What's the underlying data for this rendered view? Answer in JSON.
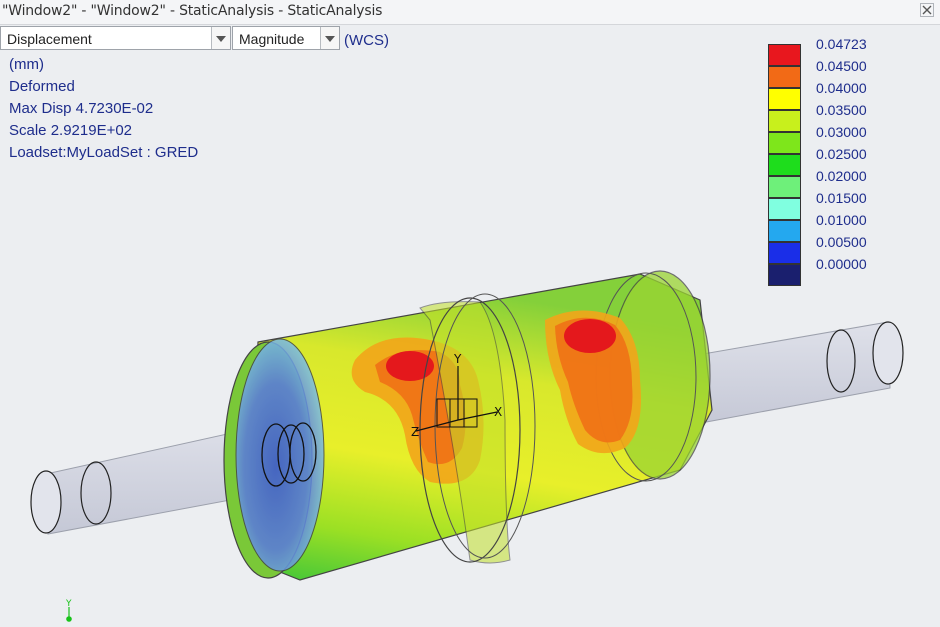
{
  "window": {
    "title": "\"Window2\" - \"Window2\" - StaticAnalysis - StaticAnalysis"
  },
  "toolbar": {
    "quantity": {
      "value": "Displacement"
    },
    "component": {
      "value": "Magnitude"
    },
    "coord_system": "(WCS)"
  },
  "info": {
    "units": "(mm)",
    "mode": "Deformed",
    "max_disp": "Max Disp  4.7230E-02",
    "scale": "Scale  2.9219E+02",
    "loadset": "Loadset:MyLoadSet :  GRED"
  },
  "legend": {
    "entries": [
      {
        "value": "0.04723",
        "color": "#e8171e"
      },
      {
        "value": "0.04500",
        "color": "#f26a16"
      },
      {
        "value": "0.04000",
        "color": "#ffff00"
      },
      {
        "value": "0.03500",
        "color": "#c8f01c"
      },
      {
        "value": "0.03000",
        "color": "#7ee61b"
      },
      {
        "value": "0.02500",
        "color": "#1edd1c"
      },
      {
        "value": "0.02000",
        "color": "#6ef07a"
      },
      {
        "value": "0.01500",
        "color": "#80ffe0"
      },
      {
        "value": "0.01000",
        "color": "#24a8ef"
      },
      {
        "value": "0.00500",
        "color": "#1a2ee8"
      },
      {
        "value": "0.00000",
        "color": "#1a1f6e"
      }
    ]
  },
  "triad": {
    "x": "X",
    "y": "Y",
    "z": "Z"
  },
  "mini_triad": {
    "y": "Y"
  },
  "icons": {
    "close": "close-icon",
    "dropdown": "chevron-down-icon"
  }
}
